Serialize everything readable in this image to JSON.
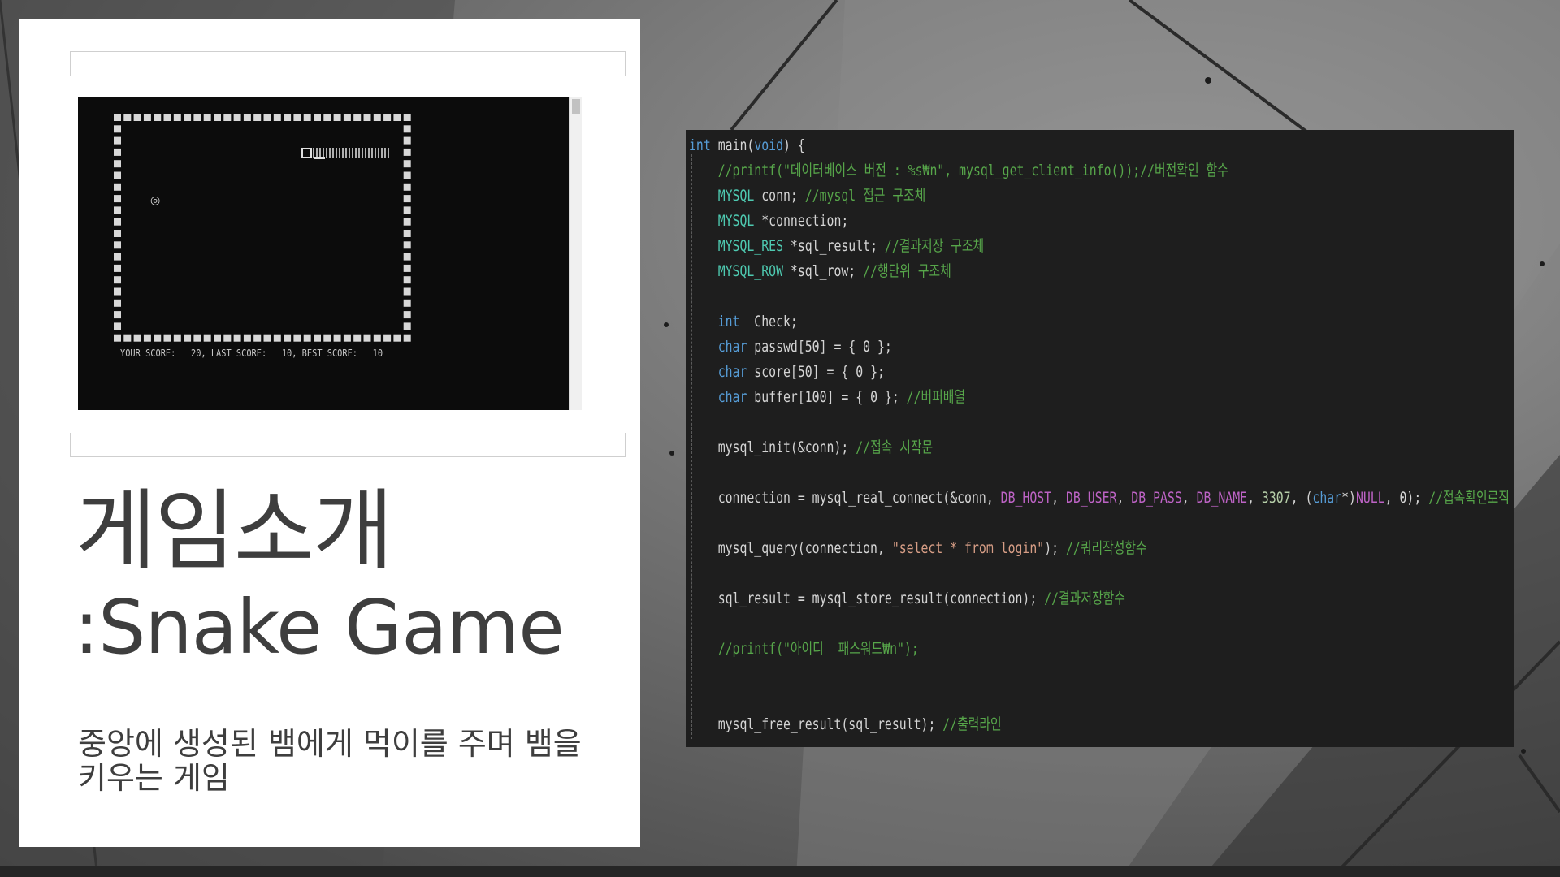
{
  "slide": {
    "title_line1": "게임소개",
    "title_line2": ":Snake Game",
    "subtitle": "중앙에 생성된 뱀에게 먹이를 주며 뱀을 키우는 게임"
  },
  "console": {
    "score_text": "YOUR SCORE:   20, LAST SCORE:   10, BEST SCORE:   10",
    "food_glyph": "◎"
  },
  "code": {
    "lines": [
      [
        {
          "t": "int",
          "c": "kw"
        },
        {
          "t": " main(",
          "c": "tx"
        },
        {
          "t": "void",
          "c": "kw"
        },
        {
          "t": ") {",
          "c": "tx"
        }
      ],
      [
        {
          "t": "    //printf(\"데이터베이스 버전 : %s₩n\", mysql_get_client_info());//버전확인 함수",
          "c": "cm"
        }
      ],
      [
        {
          "t": "    MYSQL",
          "c": "ty"
        },
        {
          "t": " conn; ",
          "c": "tx"
        },
        {
          "t": "//mysql 접근 구조체",
          "c": "cm"
        }
      ],
      [
        {
          "t": "    MYSQL",
          "c": "ty"
        },
        {
          "t": " *connection;",
          "c": "tx"
        }
      ],
      [
        {
          "t": "    MYSQL_RES",
          "c": "ty"
        },
        {
          "t": " *sql_result; ",
          "c": "tx"
        },
        {
          "t": "//결과저장 구조체",
          "c": "cm"
        }
      ],
      [
        {
          "t": "    MYSQL_ROW",
          "c": "ty"
        },
        {
          "t": " *sql_row; ",
          "c": "tx"
        },
        {
          "t": "//행단위 구조체",
          "c": "cm"
        }
      ],
      [],
      [
        {
          "t": "    int",
          "c": "kw"
        },
        {
          "t": "  Check;",
          "c": "tx"
        }
      ],
      [
        {
          "t": "    char",
          "c": "kw"
        },
        {
          "t": " passwd[50] = { 0 };",
          "c": "tx"
        }
      ],
      [
        {
          "t": "    char",
          "c": "kw"
        },
        {
          "t": " score[50] = { 0 };",
          "c": "tx"
        }
      ],
      [
        {
          "t": "    char",
          "c": "kw"
        },
        {
          "t": " buffer[100] = { 0 }; ",
          "c": "tx"
        },
        {
          "t": "//버퍼배열",
          "c": "cm"
        }
      ],
      [],
      [
        {
          "t": "    mysql_init(&conn); ",
          "c": "tx"
        },
        {
          "t": "//접속 시작문",
          "c": "cm"
        }
      ],
      [],
      [
        {
          "t": "    connection = mysql_real_connect(&conn, ",
          "c": "tx"
        },
        {
          "t": "DB_HOST",
          "c": "mc"
        },
        {
          "t": ", ",
          "c": "tx"
        },
        {
          "t": "DB_USER",
          "c": "mc"
        },
        {
          "t": ", ",
          "c": "tx"
        },
        {
          "t": "DB_PASS",
          "c": "mc"
        },
        {
          "t": ", ",
          "c": "tx"
        },
        {
          "t": "DB_NAME",
          "c": "mc"
        },
        {
          "t": ", ",
          "c": "tx"
        },
        {
          "t": "3307",
          "c": "nm"
        },
        {
          "t": ", (",
          "c": "tx"
        },
        {
          "t": "char",
          "c": "kw"
        },
        {
          "t": "*)",
          "c": "tx"
        },
        {
          "t": "NULL",
          "c": "mc"
        },
        {
          "t": ", 0); ",
          "c": "tx"
        },
        {
          "t": "//접속확인로직",
          "c": "cm"
        }
      ],
      [],
      [
        {
          "t": "    mysql_query(connection, ",
          "c": "tx"
        },
        {
          "t": "\"select * from login\"",
          "c": "st"
        },
        {
          "t": "); ",
          "c": "tx"
        },
        {
          "t": "//쿼리작성함수",
          "c": "cm"
        }
      ],
      [],
      [
        {
          "t": "    sql_result = mysql_store_result(connection); ",
          "c": "tx"
        },
        {
          "t": "//결과저장함수",
          "c": "cm"
        }
      ],
      [],
      [
        {
          "t": "    //printf(\"아이디  패스워드₩n\");",
          "c": "cm"
        }
      ],
      [],
      [],
      [
        {
          "t": "    mysql_free_result(sql_result); ",
          "c": "tx"
        },
        {
          "t": "//출력라인",
          "c": "cm"
        }
      ]
    ]
  },
  "colors": {
    "keyword": "#569cd6",
    "type": "#4ec9b0",
    "comment": "#57a64a",
    "string": "#d69d85",
    "macro": "#bd63c5",
    "number": "#b5cea8",
    "title_text": "#3e3e3e"
  }
}
